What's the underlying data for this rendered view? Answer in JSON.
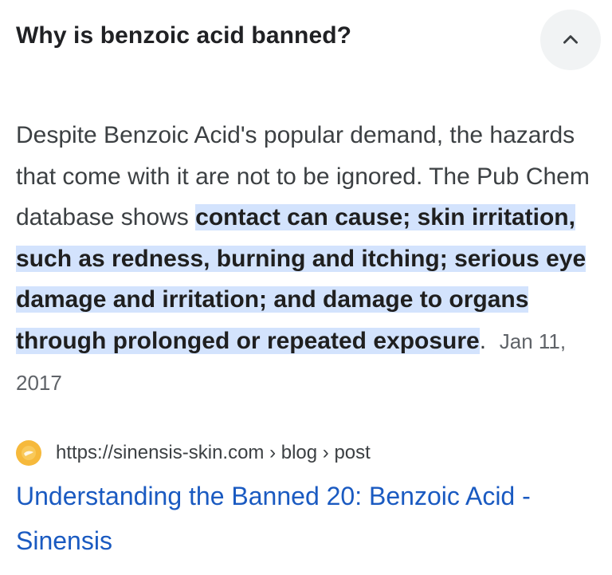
{
  "question": {
    "text": "Why is benzoic acid banned?",
    "toggle_icon": "chevron-up-icon"
  },
  "snippet": {
    "plain_text": "Despite Benzoic Acid's popular demand, the hazards that come with it are not to be ignored. The Pub Chem database shows ",
    "highlighted_text": "contact can cause; skin irritation, such as redness, burning and itching; serious eye damage and irritation; and damage to organs through prolonged or repeated exposure",
    "trailing_text": ".",
    "date": "Jan 11, 2017"
  },
  "source": {
    "favicon": "sinensis-logo-icon",
    "url": "https://sinensis-skin.com › blog › post"
  },
  "result": {
    "title": "Understanding the Banned 20: Benzoic Acid - Sinensis"
  },
  "colors": {
    "highlight": "#d3e3fd",
    "link": "#1a5ac1",
    "favicon": "#f6b93b",
    "button_bg": "#f1f3f4"
  }
}
